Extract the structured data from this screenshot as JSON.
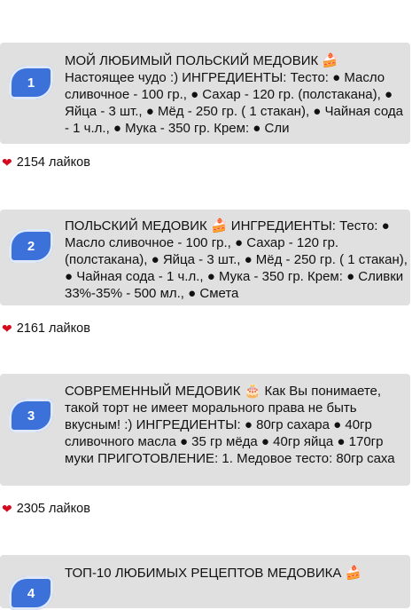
{
  "posts": [
    {
      "number": "1",
      "text": "МОЙ ЛЮБИМЫЙ ПОЛЬСКИЙ МЕДОВИК 🍰 Настоящее чудо :) ИНГРЕДИЕНТЫ: Тесто: ● Масло сливочное - 100 гр., ● Сахар - 120 гр. (полстакана), ● Яйца - 3 шт., ● Мёд - 250 гр. ( 1 стакан), ● Чайная сода - 1 ч.л., ● Мука - 350 гр. Крем: ● Сли",
      "likes": "2154 лайков"
    },
    {
      "number": "2",
      "text": "ПОЛЬСКИЙ МЕДОВИК 🍰 ИНГРЕДИЕНТЫ: Тесто: ● Масло сливочное - 100 гр., ● Сахар - 120 гр. (полстакана), ● Яйца - 3 шт., ● Мёд - 250 гр. ( 1 стакан), ● Чайная сода - 1 ч.л., ● Мука - 350 гр. Крем: ● Сливки 33%-35% - 500 мл., ● Смета",
      "likes": "2161 лайков"
    },
    {
      "number": "3",
      "text": "СОВРЕМЕННЫЙ МЕДОВИК 🎂 Как Вы понимаете, такой торт не имеет морального права не быть вкусным! :) ИНГРЕДИЕНТЫ: ● 80гр сахара ● 40гр сливочного масла ● 35 гр мёда ● 40гр яйца ● 170гр муки ПРИГОТОВЛЕНИЕ: 1. Медовое тесто: 80гр саха",
      "likes": "2305 лайков"
    },
    {
      "number": "4",
      "text": "ТОП-10 ЛЮБИМЫХ РЕЦЕПТОВ МЕДОВИКА 🍰"
    }
  ]
}
